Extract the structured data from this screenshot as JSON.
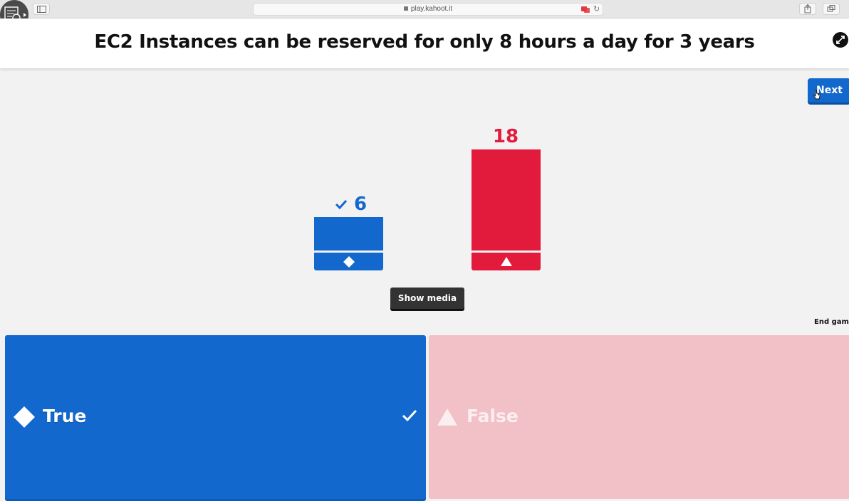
{
  "browser": {
    "url": "play.kahoot.it"
  },
  "question": {
    "text": "EC2 Instances can be reserved for only 8 hours a day for 3 years"
  },
  "controls": {
    "next_label": "Next",
    "show_media_label": "Show media",
    "end_game_label": "End game"
  },
  "colors": {
    "blue": "#1368ce",
    "red": "#e21b3c",
    "false_faded": "#f2c1c7"
  },
  "results": {
    "true_count": "6",
    "false_count": "18"
  },
  "answers": [
    {
      "label": "True",
      "shape": "diamond-icon",
      "correct": true
    },
    {
      "label": "False",
      "shape": "triangle-icon",
      "correct": false
    }
  ],
  "chart_data": {
    "type": "bar",
    "categories": [
      "True",
      "False"
    ],
    "values": [
      6,
      18
    ]
  }
}
